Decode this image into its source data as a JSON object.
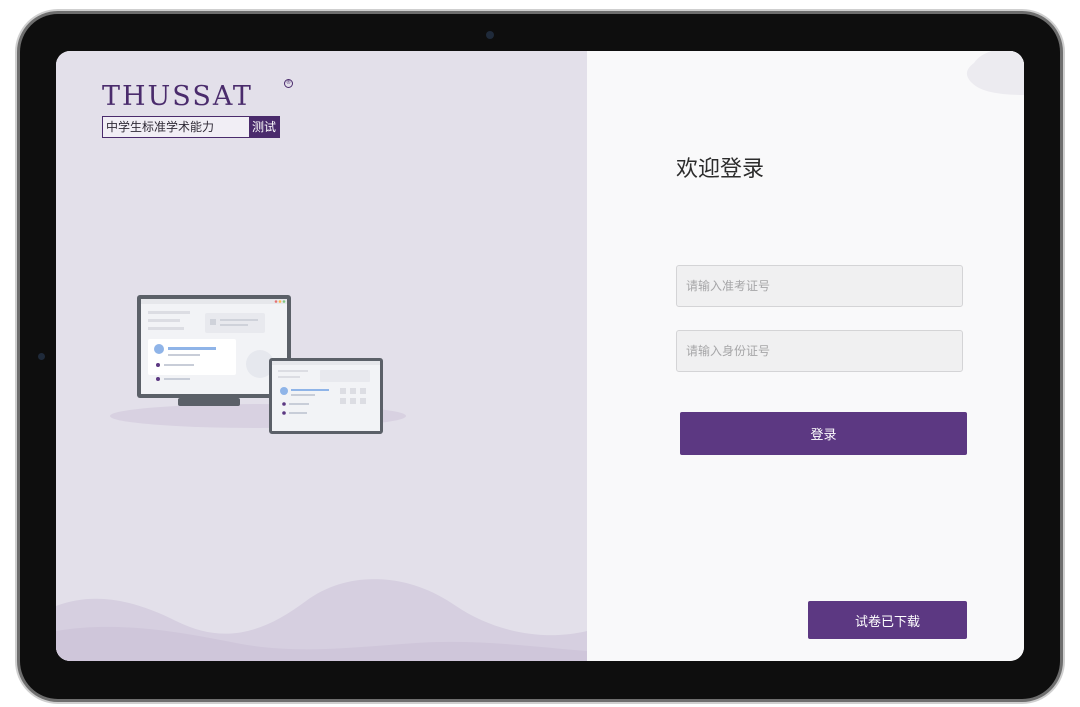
{
  "brand": {
    "logo_text": "THUSSAT",
    "subtitle_main": "中学生标准学术能力",
    "subtitle_accent": "测试",
    "registered_mark": "®",
    "primary_color": "#5c3882",
    "left_panel_color": "#e3e0ea"
  },
  "login": {
    "title": "欢迎登录",
    "exam_id_placeholder": "请输入准考证号",
    "exam_id_value": "",
    "id_card_placeholder": "请输入身份证号",
    "id_card_value": "",
    "login_label": "登录",
    "download_label": "试卷已下载"
  },
  "illustration": {
    "icon": "monitor-and-tablet-illustration"
  }
}
